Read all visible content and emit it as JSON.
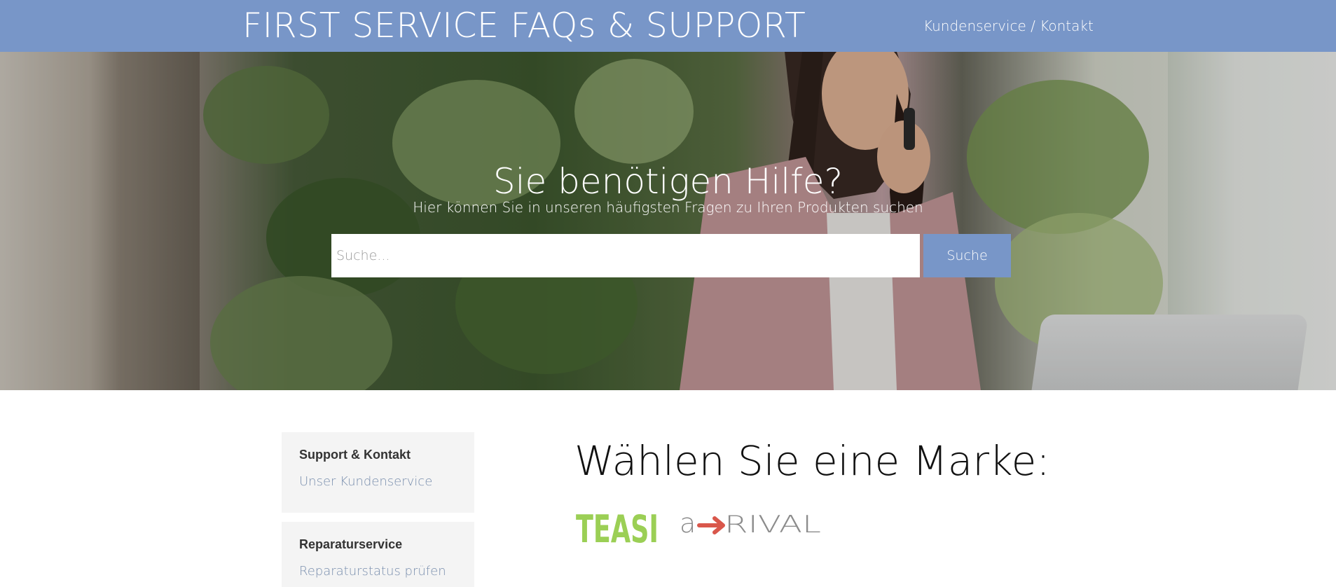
{
  "header": {
    "site_title": "FIRST SERVICE FAQs & SUPPORT",
    "contact_link": "Kundenservice / Kontakt",
    "bar_color": "#7896c8"
  },
  "hero": {
    "heading": "Sie benötigen Hilfe?",
    "subheading": "Hier können Sie in unseren häufigsten Fragen zu Ihren Produkten suchen",
    "search": {
      "placeholder": "Suche...",
      "value": "",
      "button_label": "Suche"
    }
  },
  "sidebar": {
    "cards": [
      {
        "heading": "Support & Kontakt",
        "links": [
          "Unser Kundenservice"
        ]
      },
      {
        "heading": "Reparaturservice",
        "links": [
          "Reparaturstatus prüfen"
        ]
      }
    ]
  },
  "brands": {
    "heading": "Wählen Sie eine Marke:",
    "items": [
      {
        "name": "TEASI",
        "logo_color": "#9bcf55"
      },
      {
        "name": "a→RIVAL",
        "logo_color": "#8c8c8c",
        "accent_color": "#d9574b"
      }
    ]
  }
}
